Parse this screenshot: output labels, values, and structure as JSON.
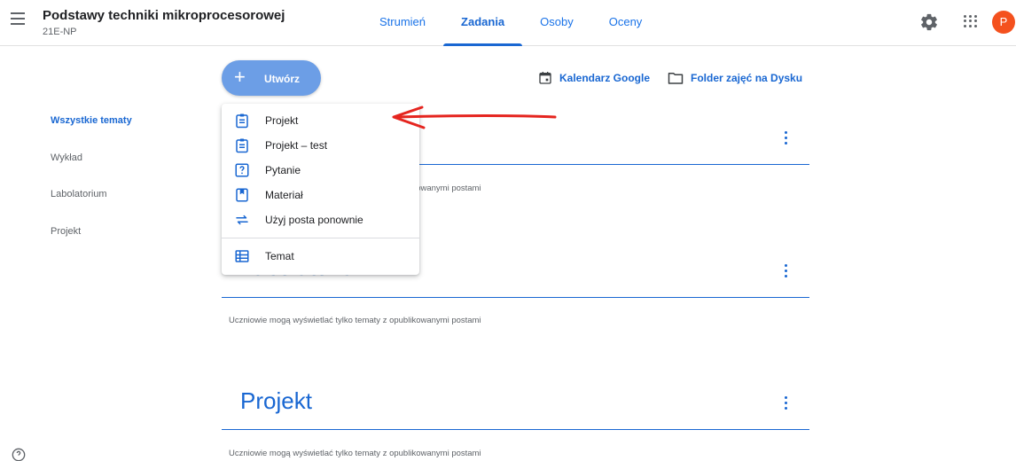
{
  "header": {
    "course_title": "Podstawy techniki mikroprocesorowej",
    "course_code": "21E-NP",
    "tabs": [
      {
        "label": "Strumień",
        "active": false
      },
      {
        "label": "Zadania",
        "active": true
      },
      {
        "label": "Osoby",
        "active": false
      },
      {
        "label": "Oceny",
        "active": false
      }
    ],
    "avatar_letter": "P",
    "avatar_color": "#f4511e",
    "icons": [
      "menu-icon",
      "gear-icon",
      "apps-icon"
    ]
  },
  "sidebar": {
    "items": [
      {
        "label": "Wszystkie tematy",
        "active": true
      },
      {
        "label": "Wykład",
        "active": false
      },
      {
        "label": "Labolatorium",
        "active": false
      },
      {
        "label": "Projekt",
        "active": false
      }
    ]
  },
  "toolbar": {
    "create_label": "Utwórz",
    "calendar_label": "Kalendarz Google",
    "drive_label": "Folder zajęć na Dysku"
  },
  "create_menu": {
    "items": [
      {
        "label": "Projekt",
        "icon": "assignment-icon"
      },
      {
        "label": "Projekt – test",
        "icon": "assignment-icon"
      },
      {
        "label": "Pytanie",
        "icon": "question-icon"
      },
      {
        "label": "Materiał",
        "icon": "material-icon"
      },
      {
        "label": "Użyj posta ponownie",
        "icon": "reuse-icon"
      },
      {
        "label": "Temat",
        "icon": "topic-icon"
      }
    ]
  },
  "topics": [
    {
      "title": "",
      "note": "Uczniowie mogą wyświetlać tylko tematy z opublikowanymi postami"
    },
    {
      "title": "Labolatorium",
      "note": "Uczniowie mogą wyświetlać tylko tematy z opublikowanymi postami"
    },
    {
      "title": "Projekt",
      "note": "Uczniowie mogą wyświetlać tylko tematy z opublikowanymi postami"
    }
  ],
  "colors": {
    "accent": "#1967d2",
    "create_button": "#6c9ee6",
    "annotation_arrow": "#e5251f"
  }
}
